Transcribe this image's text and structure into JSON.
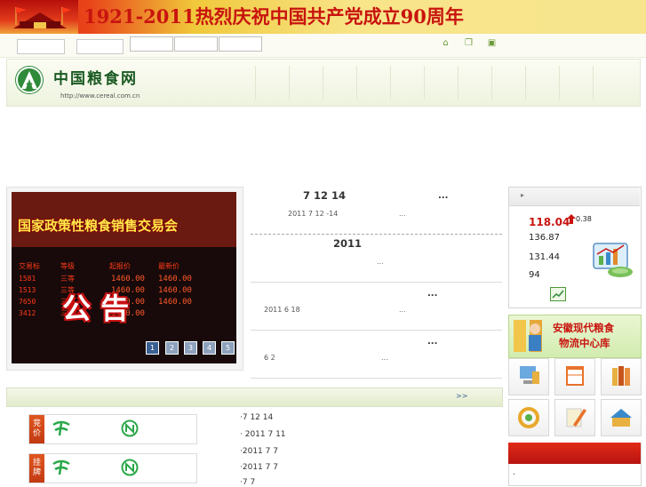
{
  "banner": {
    "title": "1921-2011热烈庆祝中国共产党成立90周年"
  },
  "header": {
    "logo_text": "中国粮食网",
    "logo_url": "http://www.cereal.com.cn",
    "top_icons": [
      "home-icon",
      "bookmark-icon",
      "window-icon"
    ]
  },
  "slideshow": {
    "sign_text": "国家政策性粮食销售交易会",
    "announce_text": "公 告",
    "board_rows": [
      "1460.00",
      "1460.00",
      "1460.00",
      "1460.00"
    ],
    "pages": [
      "1",
      "2",
      "3",
      "4",
      "5"
    ],
    "active_page": "1"
  },
  "news": {
    "item1_title": "7 12  14",
    "item1_ellipsis": "...",
    "item1_date": "2011 7 12 -14",
    "item1_more": "...",
    "item2_title": "2011",
    "item2_more": "...",
    "item3_ellipsis": "...",
    "item3_date": "2011 6 18",
    "item3_more": "...",
    "item4_ellipsis": "...",
    "item4_date": "6 2",
    "item4_more": "..."
  },
  "price": {
    "main": "118.04",
    "change": "0.38",
    "v1": "136.87",
    "v2": "131.44",
    "v3": "94",
    "head_arrow": "▸"
  },
  "anhui": {
    "line1": "安徽现代粮食",
    "line2": "物流中心库"
  },
  "bottom": {
    "more": ">>",
    "row1_badge": "竞价",
    "row2_badge": "挂牌",
    "links": [
      "·7 12  14",
      "·    2011 7 11",
      "·2011 7 7",
      "·2011 7 7",
      "·7 7"
    ],
    "right_dot": "."
  }
}
